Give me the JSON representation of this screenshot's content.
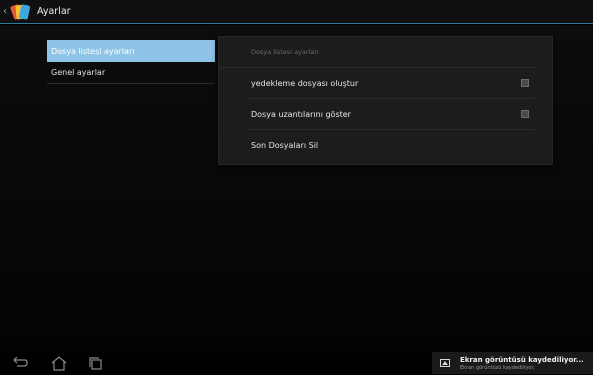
{
  "actionbar": {
    "title": "Ayarlar",
    "app_icon": "file-manager-icon"
  },
  "left_list": {
    "items": [
      {
        "label": "Dosya listesi ayarları",
        "selected": true
      },
      {
        "label": "Genel ayarlar",
        "selected": false
      }
    ]
  },
  "panel": {
    "header": "Dosya listesi ayarları",
    "prefs": [
      {
        "label": "yedekleme dosyası oluştur",
        "checked": false
      },
      {
        "label": "Dosya uzantılarını göster",
        "checked": false
      },
      {
        "label": "Son Dosyaları Sil"
      }
    ]
  },
  "navbar": {
    "buttons": [
      "back-icon",
      "home-icon",
      "recent-apps-icon"
    ]
  },
  "notification": {
    "icon": "screenshot-icon",
    "title": "Ekran görüntüsü kaydediliyor...",
    "subtitle": "Ekran görüntüsü kaydediliyor."
  },
  "colors": {
    "accent": "#2a7a9c",
    "selected_item": "#8fc4e6"
  }
}
